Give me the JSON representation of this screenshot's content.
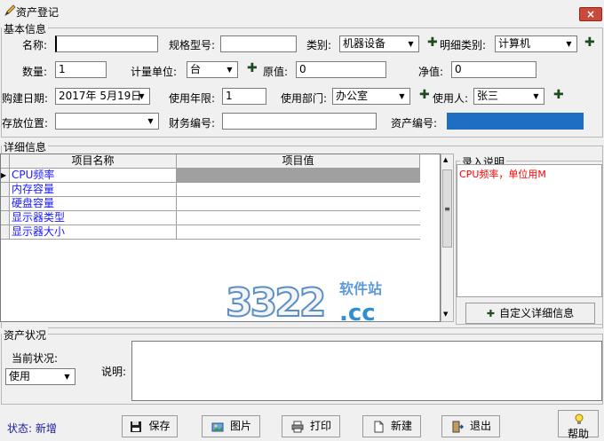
{
  "window": {
    "title": "资产登记",
    "close_label": "×"
  },
  "basic": {
    "label": "基本信息",
    "name_label": "名称:",
    "name_value": "",
    "spec_label": "规格型号:",
    "spec_value": "",
    "category_label": "类别:",
    "category_value": "机器设备",
    "subcategory_label": "明细类别:",
    "subcategory_value": "计算机",
    "quantity_label": "数量:",
    "quantity_value": "1",
    "unit_label": "计量单位:",
    "unit_value": "台",
    "original_label": "原值:",
    "original_value": "0",
    "net_label": "净值:",
    "net_value": "0",
    "purchase_date_label": "购建日期:",
    "purchase_date_value": "2017年 5月19日",
    "life_label": "使用年限:",
    "life_value": "1",
    "dept_label": "使用部门:",
    "dept_value": "办公室",
    "user_label": "使用人:",
    "user_value": "张三",
    "location_label": "存放位置:",
    "location_value": "",
    "finance_label": "财务编号:",
    "finance_value": "",
    "asset_no_label": "资产编号:",
    "asset_no_value": ""
  },
  "detail": {
    "label": "详细信息",
    "col_name": "项目名称",
    "col_value": "项目值",
    "rows": [
      {
        "name": "CPU频率",
        "value": ""
      },
      {
        "name": "内存容量",
        "value": ""
      },
      {
        "name": "硬盘容量",
        "value": ""
      },
      {
        "name": "显示器类型",
        "value": ""
      },
      {
        "name": "显示器大小",
        "value": ""
      }
    ],
    "note_label": "录入说明",
    "note_text": "CPU频率，单位用M",
    "custom_button": "自定义详细信息"
  },
  "watermark": {
    "number": "3322",
    "domain": ".cc",
    "site": "软件站"
  },
  "status_section": {
    "label": "资产状况",
    "current_label": "当前状况:",
    "current_value": "使用",
    "desc_label": "说明:",
    "desc_value": ""
  },
  "footer": {
    "status_text": "状态: 新增",
    "save": "保存",
    "picture": "图片",
    "print": "打印",
    "new": "新建",
    "exit": "退出",
    "help": "帮助"
  },
  "colors": {
    "asset_no_fill": "#1e6fc4",
    "note_text": "#ff0000",
    "item_name": "#1a1aff",
    "status_text": "#1a1a9e",
    "close_button": "#c94a3b"
  }
}
